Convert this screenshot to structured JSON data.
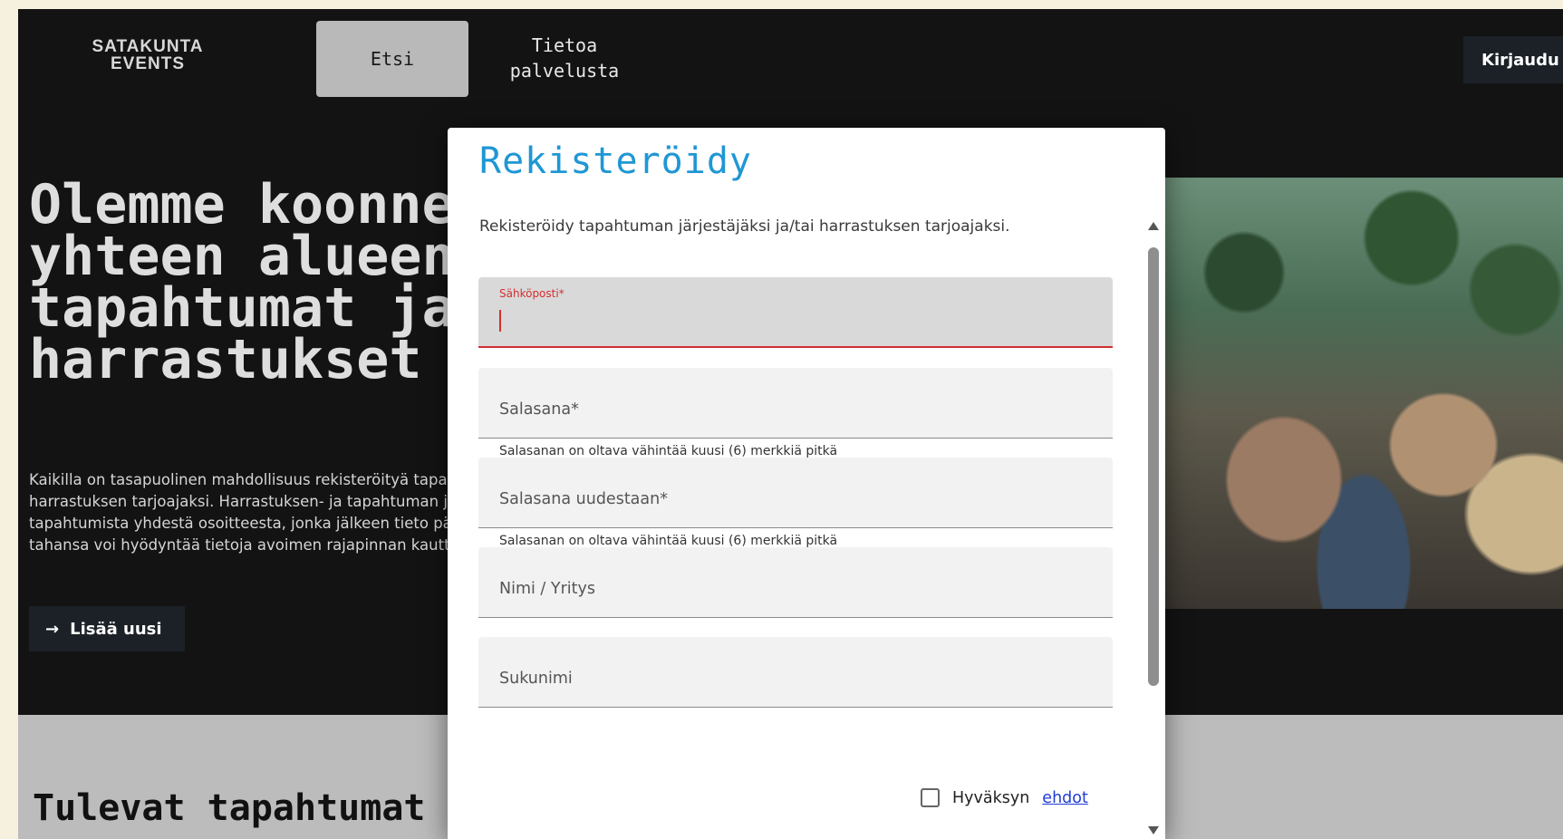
{
  "nav": {
    "logo_line1": "SATAKUNTA",
    "logo_line2": "EVENTS",
    "tab_search": "Etsi",
    "tab_about_line1": "Tietoa",
    "tab_about_line2": "palvelusta",
    "login_label": "Kirjaudu"
  },
  "hero": {
    "title": "Olemme koonneet\nyhteen alueen\ntapahtumat ja\nharrastukset",
    "description": "Kaikilla on tasapuolinen mahdollisuus rekisteröityä tapahtuman järjestäjäksi ja/tai harrastuksen tarjoajaksi. Harrastuksen- ja tapahtuman järjestäjät voivat ilmoittaa tapahtumista yhdestä osoitteesta, jonka jälkeen tieto päivittyy kaikkiin palveluihin. Kuka tahansa voi hyödyntää tietoja avoimen rajapinnan kautta.",
    "add_button": "Lisää uusi",
    "add_icon": "→"
  },
  "section": {
    "title": "Tulevat tapahtumat"
  },
  "modal": {
    "title": "Rekisteröidy",
    "description": "Rekisteröidy tapahtuman järjestäjäksi ja/tai harrastuksen tarjoajaksi.",
    "fields": [
      {
        "label": "Sähköposti*",
        "value": "",
        "state": "focused-error"
      },
      {
        "label": "Salasana*",
        "value": "",
        "helper": "Salasanan on oltava vähintää kuusi (6) merkkiä pitkä"
      },
      {
        "label": "Salasana uudestaan*",
        "value": "",
        "helper": "Salasanan on oltava vähintää kuusi (6) merkkiä pitkä"
      },
      {
        "label": "Nimi / Yritys",
        "value": ""
      },
      {
        "label": "Sukunimi",
        "value": ""
      }
    ],
    "terms_text": "Hyväksyn",
    "terms_link": "ehdot",
    "terms_checked": false
  },
  "colors": {
    "background": "#131313",
    "modal_title": "#1f97d4",
    "error": "#d32f2f",
    "link": "#1f3cd6",
    "page_outer": "#f6f1df"
  }
}
